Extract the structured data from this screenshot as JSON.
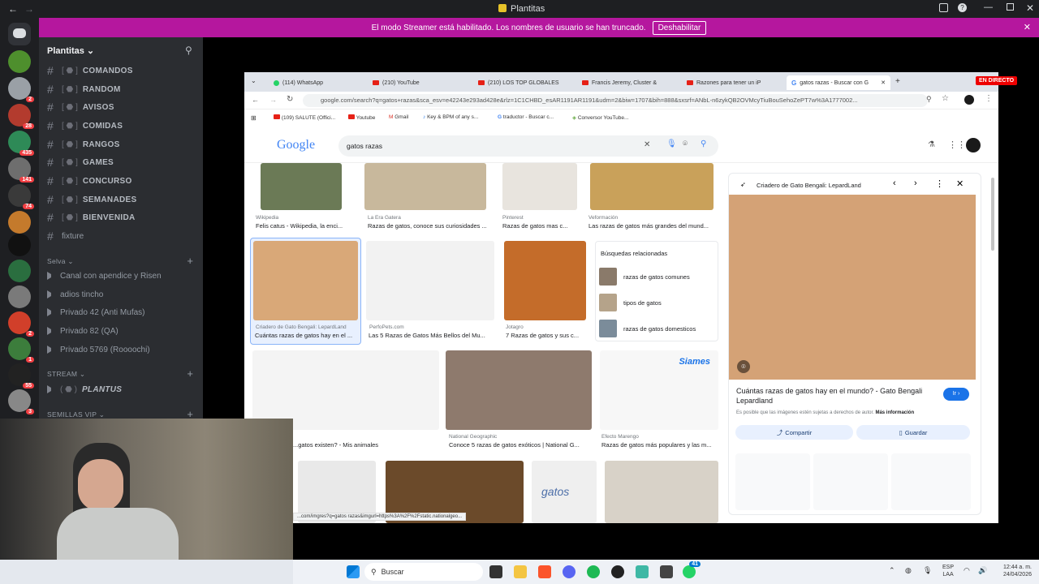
{
  "window": {
    "title": "Plantitas"
  },
  "banner": {
    "text": "El modo Streamer está habilitado. Los nombres de usuario se han truncado.",
    "button": "Deshabilitar"
  },
  "server": {
    "name": "Plantitas"
  },
  "guild_badges": [
    "2",
    "28",
    "435",
    "141",
    "74",
    "2",
    "1",
    "55",
    "3"
  ],
  "channels": [
    {
      "name": "COMANDOS"
    },
    {
      "name": "RANDOM"
    },
    {
      "name": "AVISOS"
    },
    {
      "name": "COMIDAS"
    },
    {
      "name": "RANGOS"
    },
    {
      "name": "GAMES"
    },
    {
      "name": "CONCURSO"
    },
    {
      "name": "SEMANADES"
    },
    {
      "name": "BIENVENIDA"
    },
    {
      "name": "fixture"
    }
  ],
  "categories": {
    "selva": "Selva",
    "stream": "STREAM",
    "semillas": "SEMILLAS VIP"
  },
  "voice_channels": [
    "Canal con apendice y Risen",
    "adios tincho",
    "Privado 42 (Anti Mufas)",
    "Privado 82 (QA)",
    "Privado 5769 (Roooochi)"
  ],
  "stream_channel": "PLANTUS",
  "browser": {
    "tabs": [
      "(114) WhatsApp",
      "(210) YouTube",
      "(210) LOS TOP GLOBALES",
      "Francis Jeremy, Cluster &",
      "Razones para tener un iP",
      "gatos razas - Buscar con G"
    ],
    "url": "google.com/search?q=gatos+razas&sca_esv=e42243e293ad428e&rlz=1C1CHBD_esAR1191AR1191&udm=2&biw=1707&bih=888&sxsrf=ANbL-n6zykQB2OVMcyTiuBouSehoZePT7w%3A1777002...",
    "bookmarks": [
      "(109) SALUTE (Offici...",
      "Youtube",
      "Gmail",
      "Key & BPM of any s...",
      "traductor - Buscar c...",
      "Conversor YouTube..."
    ],
    "live": "EN DIRECTO"
  },
  "google": {
    "logo": "Google",
    "query": "gatos razas",
    "results_row1": [
      {
        "source": "Wikipedia",
        "title": "Felis catus - Wikipedia, la enci..."
      },
      {
        "source": "La Era Gatera",
        "title": "Razas de gatos, conoce sus curiosidades ..."
      },
      {
        "source": "Pinterest",
        "title": "Razas de gatos mas c..."
      },
      {
        "source": "Veformación",
        "title": "Las razas de gatos más grandes del mund..."
      }
    ],
    "results_row2": [
      {
        "source": "Criadero de Gato Bengali: LepardLand",
        "title": "Cuántas razas de gatos hay en el ..."
      },
      {
        "source": "PerfoPets.com",
        "title": "Las 5 Razas de Gatos Más Bellos del Mu..."
      },
      {
        "source": "Jotagro",
        "title": "7 Razas de gatos y sus c..."
      }
    ],
    "related": {
      "title": "Búsquedas relacionadas",
      "items": [
        "razas de gatos comunes",
        "tipos de gatos",
        "razas de gatos domesticos"
      ]
    },
    "results_row3": [
      {
        "source": "",
        "title": "...gatos existen? - Mis animales"
      },
      {
        "source": "National Geographic",
        "title": "Conoce 5 razas de gatos exóticos | National G..."
      },
      {
        "source": "Efecto Marengo",
        "title": "Razas de gatos más populares y las m..."
      }
    ],
    "siames_label": "Siames",
    "gatos_label": "gatos",
    "status_url": "...com/imgres?q=gatos razas&imgurl=https%3A%2F%2Fstatic.nationalgeo...",
    "preview": {
      "source": "Criadero de Gato Bengali: LepardLand",
      "title": "Cuántas razas de gatos hay en el mundo? - Gato Bengali Lepardland",
      "go": "Ir",
      "disclaimer": "Es posible que las imágenes estén sujetas a derechos de autor.",
      "more": "Más información",
      "share": "Compartir",
      "save": "Guardar"
    }
  },
  "taskbar": {
    "search": "Buscar",
    "lang": "ESP",
    "lang2": "LAA",
    "time": "12:44 a. m.",
    "date": "24/04/2026",
    "badge": "41"
  }
}
